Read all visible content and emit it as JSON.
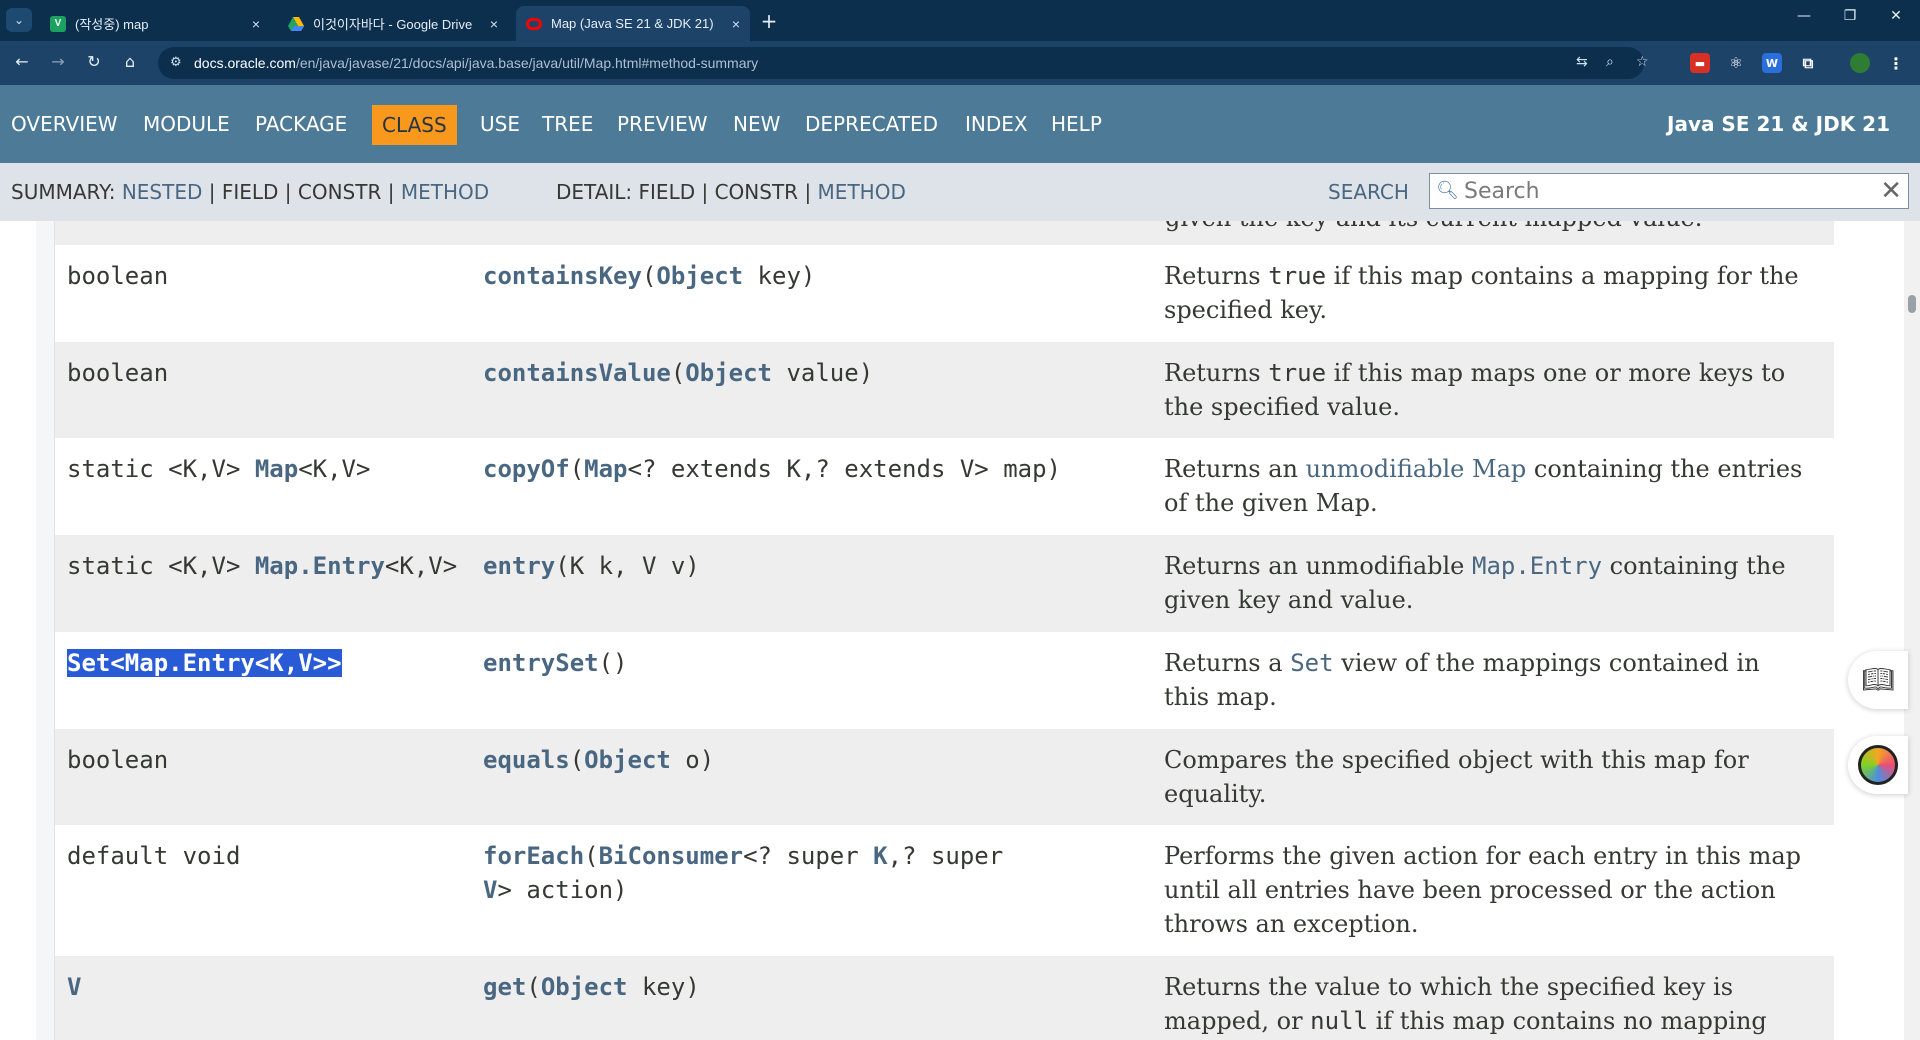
{
  "browser": {
    "tabs": [
      {
        "favicon": "V",
        "title": "(작성중) map",
        "close": "×"
      },
      {
        "favicon": "drive-icon",
        "title": "이것이자바다 - Google Drive",
        "close": "×"
      },
      {
        "favicon": "oracle-icon",
        "title": "Map (Java SE 21 & JDK 21)",
        "close": "×"
      }
    ],
    "new_tab": "+",
    "url_host": "docs.oracle.com",
    "url_path": "/en/java/javase/21/docs/api/java.base/java/util/Map.html#method-summary"
  },
  "javadoc": {
    "nav_items": [
      "OVERVIEW",
      "MODULE",
      "PACKAGE",
      "CLASS",
      "USE",
      "TREE",
      "PREVIEW",
      "NEW",
      "DEPRECATED",
      "INDEX",
      "HELP"
    ],
    "about": "Java SE 21 & JDK 21",
    "summary": {
      "label": "SUMMARY:",
      "nested": "NESTED",
      "field": "FIELD",
      "constr": "CONSTR",
      "method": "METHOD",
      "sep": "|"
    },
    "detail": {
      "label": "DETAIL:",
      "field": "FIELD",
      "constr": "CONSTR",
      "method": "METHOD",
      "sep": "|"
    },
    "search_label": "SEARCH",
    "search_placeholder": "Search",
    "search_clear": "✕"
  },
  "methods": {
    "cut_off_text": "given the key and its current mapped value.",
    "containsKey": {
      "modifier": "boolean",
      "name": "containsKey",
      "open": "(",
      "ptype": "Object",
      "rest": " key)",
      "desc_a": "Returns ",
      "desc_code": "true",
      "desc_b": " if this map contains a mapping for the specified key."
    },
    "containsValue": {
      "modifier": "boolean",
      "name": "containsValue",
      "open": "(",
      "ptype": "Object",
      "rest": " value)",
      "desc_a": "Returns ",
      "desc_code": "true",
      "desc_b": " if this map maps one or more keys to the specified value."
    },
    "copyOf": {
      "mod_a": "static <K,V> ",
      "mod_type": "Map",
      "mod_b": "<K,V>",
      "name": "copyOf",
      "open": "(",
      "ptype": "Map",
      "rest": "<? extends K,? extends V> map)",
      "desc_a": "Returns an ",
      "desc_link": "unmodifiable Map",
      "desc_b": " containing the entries of the given Map."
    },
    "entry": {
      "mod_a": "static <K,V> ",
      "mod_type": "Map.Entry",
      "mod_b": "<K,V>",
      "name": "entry",
      "rest": "(K k, V v)",
      "desc_a": "Returns an unmodifiable ",
      "desc_code": "Map.Entry",
      "desc_b": " containing the given key and value."
    },
    "entrySet": {
      "modifier": "Set<Map.Entry<K,V>>",
      "name": "entrySet",
      "rest": "()",
      "desc_a": "Returns a ",
      "desc_code": "Set",
      "desc_b": " view of the mappings contained in this map."
    },
    "equals": {
      "modifier": "boolean",
      "name": "equals",
      "open": "(",
      "ptype": "Object",
      "rest": " o)",
      "desc": "Compares the specified object with this map for equality."
    },
    "forEach": {
      "modifier": "default void",
      "name": "forEach",
      "open": "(",
      "ptype": "BiConsumer",
      "mid_a": "<? super ",
      "k": "K",
      "mid_b": ",? super ",
      "v": "V",
      "rest": "> action)",
      "desc": "Performs the given action for each entry in this map until all entries have been processed or the action throws an exception."
    },
    "get": {
      "modifier": "V",
      "name": "get",
      "open": "(",
      "ptype": "Object",
      "rest": " key)",
      "desc_a": "Returns the value to which the specified key is mapped, or ",
      "desc_code": "null",
      "desc_b": " if this map contains no mapping"
    }
  }
}
